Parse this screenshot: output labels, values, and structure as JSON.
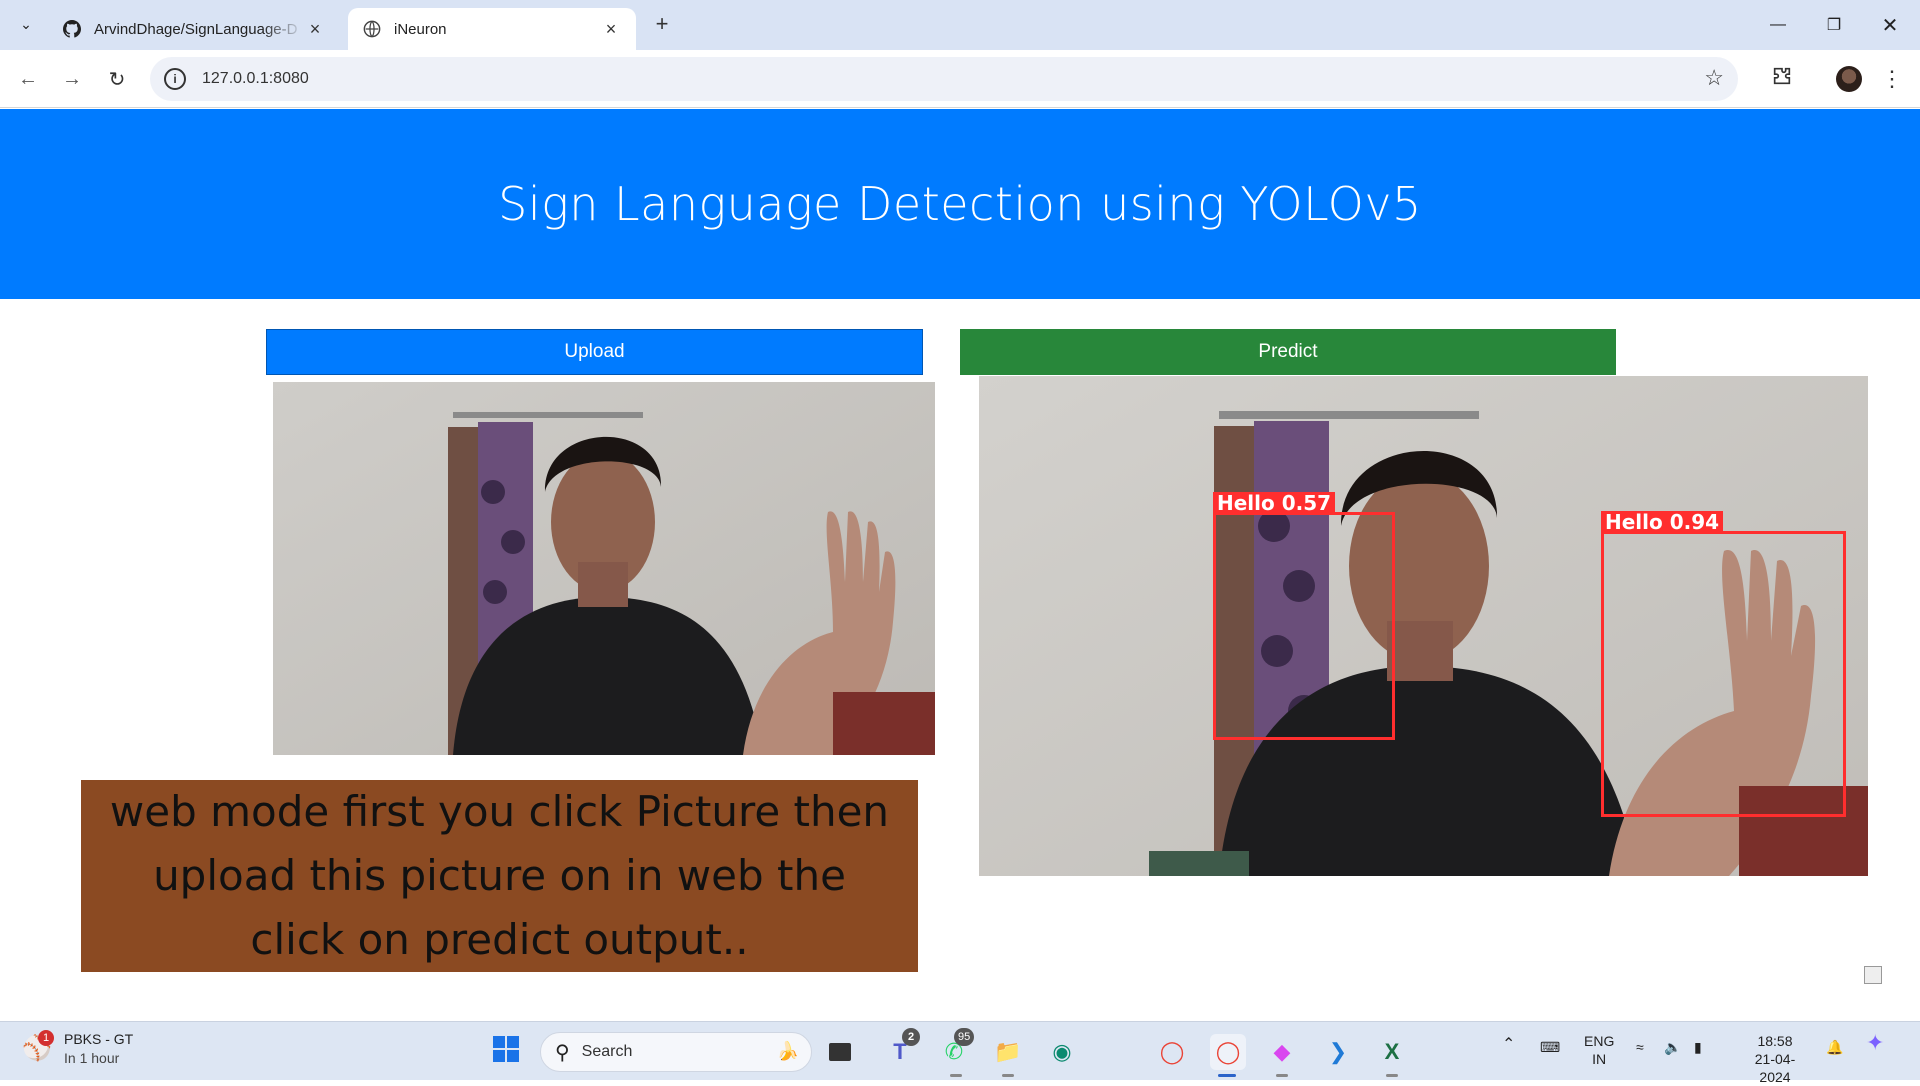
{
  "browser": {
    "tabs": [
      {
        "title": "ArvindDhage/SignLanguage-D",
        "favicon": "github-icon",
        "active": false
      },
      {
        "title": "iNeuron",
        "favicon": "globe-icon",
        "active": true
      }
    ],
    "url": "127.0.0.1:8080"
  },
  "page": {
    "title": "Sign Language Detection using YOLOv5",
    "upload_label": "Upload",
    "predict_label": "Predict",
    "note": "web mode first you click Picture then upload this picture on in web the click on predict output..",
    "detections": [
      {
        "label": "Hello 0.57",
        "class": "Hello",
        "confidence": 0.57
      },
      {
        "label": "Hello 0.94",
        "class": "Hello",
        "confidence": 0.94
      }
    ]
  },
  "taskbar": {
    "weather_title": "PBKS - GT",
    "weather_sub": "In 1 hour",
    "weather_badge": "1",
    "search_label": "Search",
    "teams_badge": "2",
    "whatsapp_badge": "95",
    "lang_line1": "ENG",
    "lang_line2": "IN",
    "time": "18:58",
    "date": "21-04-2024"
  },
  "colors": {
    "hero_bg": "#007bff",
    "upload_bg": "#007bff",
    "predict_bg": "#28873a",
    "note_bg": "#8b4a22",
    "detection": "#ff2e2e"
  }
}
